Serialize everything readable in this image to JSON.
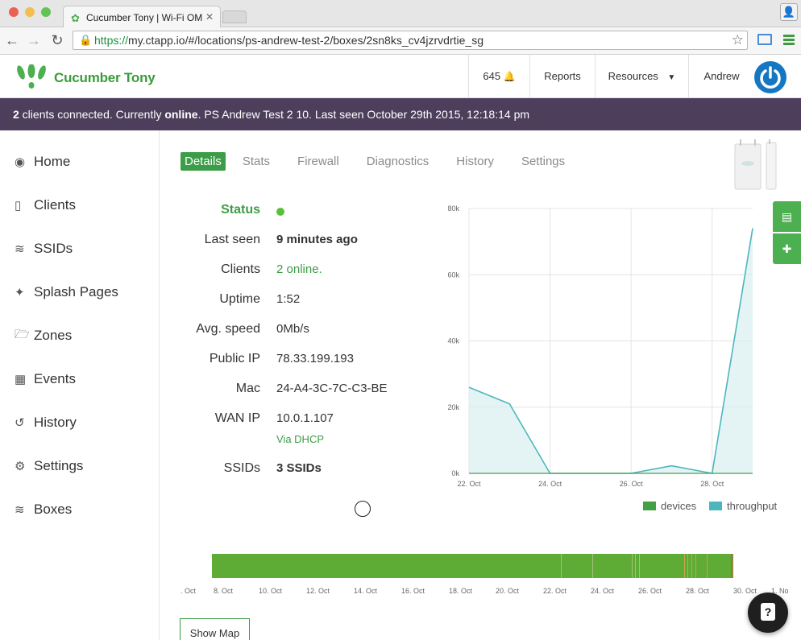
{
  "browser": {
    "tab_title": "Cucumber Tony | Wi-Fi OM",
    "url_scheme": "https://",
    "url_rest": "my.ctapp.io/#/locations/ps-andrew-test-2/boxes/2sn8ks_cv4jzrvdrtie_sg",
    "icons": [
      "back-icon",
      "forward-icon",
      "reload-icon",
      "lock-icon",
      "star-icon",
      "cast-icon",
      "menu-icon"
    ]
  },
  "header": {
    "brand": "Cucumber Tony",
    "notifications_count": "645",
    "reports_label": "Reports",
    "resources_label": "Resources",
    "user_label": "Andrew"
  },
  "banner": {
    "count": "2",
    "text1": " clients connected. Currently ",
    "status": "online",
    "text2": ". PS Andrew Test 2 10. Last seen October 29th 2015, 12:18:14 pm"
  },
  "sidebar": {
    "items": [
      {
        "label": "Home",
        "icon": "dashboard-icon"
      },
      {
        "label": "Clients",
        "icon": "tablet-icon"
      },
      {
        "label": "SSIDs",
        "icon": "wifi-icon"
      },
      {
        "label": "Splash Pages",
        "icon": "magic-wand-icon"
      },
      {
        "label": "Zones",
        "icon": "folder-icon"
      },
      {
        "label": "Events",
        "icon": "calendar-icon"
      },
      {
        "label": "History",
        "icon": "history-icon"
      },
      {
        "label": "Settings",
        "icon": "cogs-icon"
      },
      {
        "label": "Boxes",
        "icon": "wifi-icon"
      }
    ]
  },
  "tabs": [
    "Details",
    "Stats",
    "Firewall",
    "Diagnostics",
    "History",
    "Settings"
  ],
  "details": {
    "status_label": "Status",
    "last_seen_label": "Last seen",
    "last_seen_value": "9 minutes ago",
    "clients_label": "Clients",
    "clients_value": "2 online.",
    "uptime_label": "Uptime",
    "uptime_value": "1:52",
    "avg_speed_label": "Avg. speed",
    "avg_speed_value": "0Mb/s",
    "public_ip_label": "Public IP",
    "public_ip_value": "78.33.199.193",
    "mac_label": "Mac",
    "mac_value": "24-A4-3C-7C-C3-BE",
    "wan_ip_label": "WAN IP",
    "wan_ip_value": "10.0.1.107",
    "wan_ip_note": "Via DHCP",
    "ssids_label": "SSIDs",
    "ssids_value": "3 SSIDs"
  },
  "chart_data": {
    "type": "area",
    "y_ticks": [
      "80k",
      "60k",
      "40k",
      "20k",
      "0k"
    ],
    "ylim": [
      0,
      80000
    ],
    "x_ticks": [
      "22. Oct",
      "24. Oct",
      "26. Oct",
      "28. Oct"
    ],
    "series": [
      {
        "name": "devices",
        "color": "#43a047",
        "values": [
          0,
          0,
          0,
          0,
          0,
          0,
          0,
          0
        ]
      },
      {
        "name": "throughput",
        "color": "#4db6bd",
        "x": [
          "22. Oct",
          "23. Oct",
          "24. Oct",
          "25. Oct",
          "26. Oct",
          "27. Oct",
          "28. Oct",
          "29. Oct"
        ],
        "values": [
          26000,
          21000,
          0,
          0,
          0,
          2300,
          0,
          74000
        ]
      }
    ],
    "legend_position": "bottom-right",
    "grid": true
  },
  "timeline": {
    "labels": [
      ". Oct",
      "8. Oct",
      "10. Oct",
      "12. Oct",
      "14. Oct",
      "16. Oct",
      "18. Oct",
      "20. Oct",
      "22. Oct",
      "24. Oct",
      "26. Oct",
      "28. Oct",
      "30. Oct",
      "1. No"
    ],
    "bar_color": "#5eab35"
  },
  "show_map_label": "Show Map",
  "help_label": "?"
}
